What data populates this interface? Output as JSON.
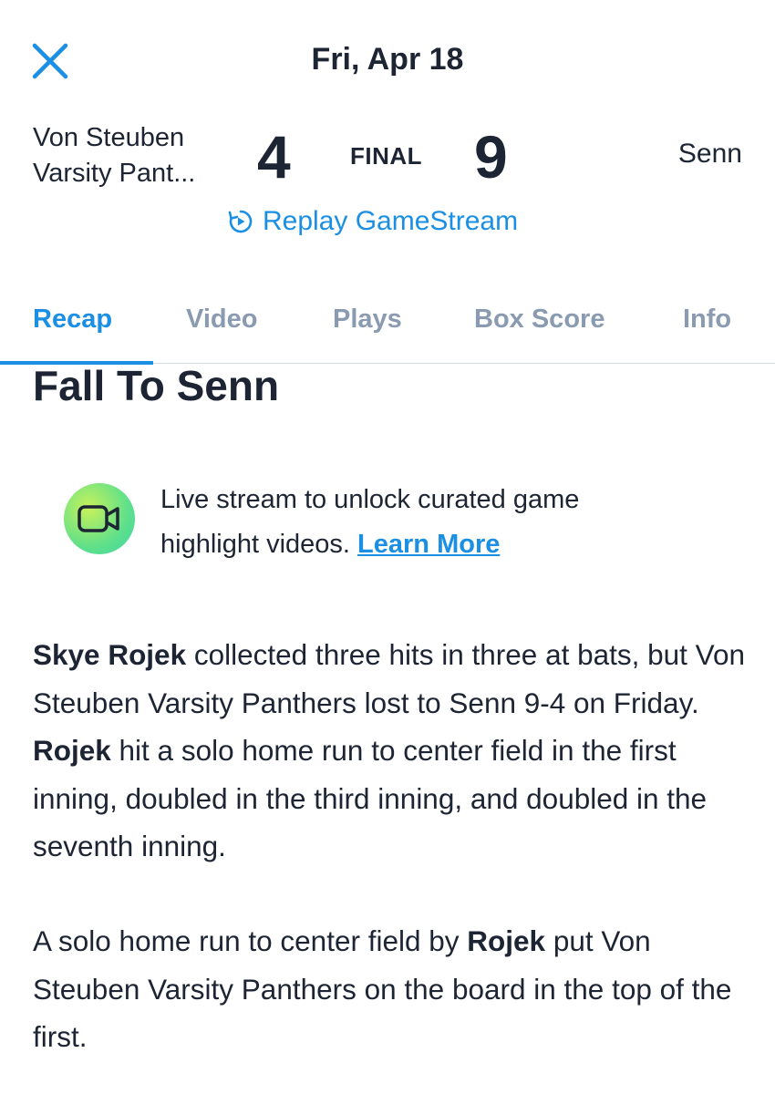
{
  "header": {
    "close_icon": "close-icon",
    "date": "Fri, Apr 18"
  },
  "scoreboard": {
    "away_team_line1": "Von Steuben",
    "away_team_line2": "Varsity Pant...",
    "away_score": "4",
    "status": "FINAL",
    "home_score": "9",
    "home_team": "Senn",
    "replay_icon": "replay-icon",
    "replay_label": "Replay GameStream"
  },
  "tabs": [
    {
      "label": "Recap",
      "active": true
    },
    {
      "label": "Video",
      "active": false
    },
    {
      "label": "Plays",
      "active": false
    },
    {
      "label": "Box Score",
      "active": false
    },
    {
      "label": "Info",
      "active": false
    }
  ],
  "recap": {
    "headline": "Fall To Senn",
    "promo": {
      "icon": "video-camera-icon",
      "text_line1": "Live stream to unlock curated game",
      "text_line2": "highlight videos.",
      "link": "Learn More"
    },
    "paragraph1": {
      "bold1": "Skye Rojek",
      "text1": " collected three hits in three at bats, but Von Steuben Varsity Panthers lost to Senn 9-4 on Friday. ",
      "bold2": "Rojek",
      "text2": " hit a solo home run to center field in the first inning, doubled in the third inning, and doubled in the seventh inning."
    },
    "paragraph2": {
      "text1": "A solo home run to center field by ",
      "bold1": "Rojek",
      "text2": " put Von Steuben Varsity Panthers on the board in the top of the first."
    }
  },
  "colors": {
    "accent": "#1a8fe3",
    "text": "#1d2433",
    "tab_inactive": "#8a9bb1"
  }
}
